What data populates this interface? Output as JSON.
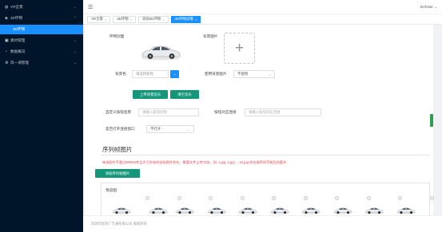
{
  "sidebar": {
    "groups": [
      {
        "label": "VR全景",
        "icon": "vr-globe-icon",
        "chevron": "⌄"
      },
      {
        "label": "3D环物",
        "icon": "cube-icon",
        "chevron": "⌃"
      }
    ],
    "active_sub": "3D环物",
    "more_groups": [
      {
        "label": "素材管理",
        "icon": "folder-icon",
        "chevron": "⌄"
      },
      {
        "label": "数据概况",
        "icon": "chart-icon",
        "chevron": "⌄"
      },
      {
        "label": "风一调管理",
        "icon": "settings-icon",
        "chevron": "⌄"
      }
    ]
  },
  "topbar": {
    "user": "techsior",
    "user_chevron": "⌄"
  },
  "tabs": [
    {
      "label": "VR全景",
      "active": false
    },
    {
      "label": "3D环物",
      "active": false
    },
    {
      "label": "添加3D环物",
      "active": false
    },
    {
      "label": "3D环物详情",
      "active": true
    }
  ],
  "tab_close": "×",
  "form": {
    "cover_label": "环物封面",
    "bg_image_label": "背景图片",
    "bg_color_label": "背景色",
    "bg_color_placeholder": "请选择颜色",
    "use_bg_label": "使用背景图片",
    "use_bg_value": "不使用",
    "upload_music_btn": "上传背景音乐",
    "clear_music_btn": "清空音乐",
    "custom_btn_label": "自定义按钮名称",
    "custom_btn_placeholder": "请输入按钮名称",
    "btn_link_label": "按钮对应连接",
    "btn_link_placeholder": "请输入按钮对应连接",
    "open_new_label": "是否打开连接窗口",
    "open_new_value": "不打开",
    "upload_plus": "+"
  },
  "frames": {
    "title": "序列帧图片",
    "warning": "每张图片不超过500KB并且大于所有的张张图片命名，需要文件上传72张，如: 1.jpg, 2.jpg ... 24.jpg 命名顺序同不能乱的要求",
    "add_btn": "添加序列帧图片",
    "preview_label": "预览图:",
    "thumb_count": 10
  },
  "footer": {
    "text": "深圳市智目广告通有限公司 版权所有"
  },
  "colors": {
    "accent": "#1890ff",
    "button_green": "#13967a",
    "sidebar_bg": "#001529",
    "warning_red": "#e5484d"
  }
}
